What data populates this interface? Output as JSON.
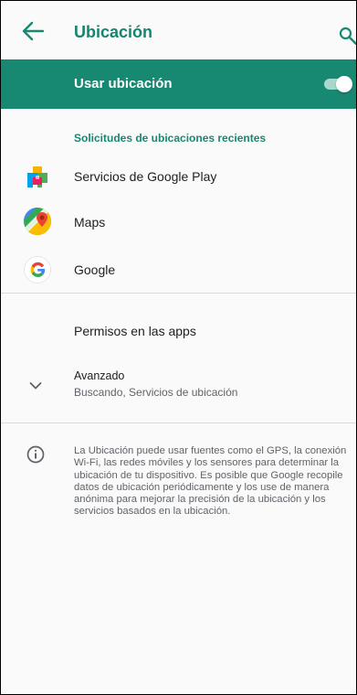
{
  "header": {
    "title": "Ubicación",
    "back_icon": "arrow-left-icon",
    "search_icon": "search-icon",
    "title_color": "#14856f"
  },
  "master_switch": {
    "label": "Usar ubicación",
    "state": "on",
    "background": "#178872"
  },
  "recent_requests": {
    "header": "Solicitudes de ubicaciones recientes",
    "apps": [
      {
        "label": "Servicios de Google Play",
        "icon": "google-play-services-icon"
      },
      {
        "label": "Maps",
        "icon": "google-maps-icon"
      },
      {
        "label": "Google",
        "icon": "google-g-icon"
      }
    ]
  },
  "preferences": {
    "app_permissions": {
      "title": "Permisos en las apps"
    },
    "advanced": {
      "title": "Avanzado",
      "summary": "Buscando, Servicios de ubicación",
      "icon": "chevron-down-icon"
    }
  },
  "footer": {
    "icon": "info-icon",
    "text": "La Ubicación puede usar fuentes como el GPS, la conexión Wi-Fi, las redes móviles y los sensores para determinar la ubicación de tu dispositivo. Es posible que Google recopile datos de ubicación periódicamente y los use de manera anónima para mejorar la precisión de la ubicación y los servicios basados en la ubicación."
  }
}
